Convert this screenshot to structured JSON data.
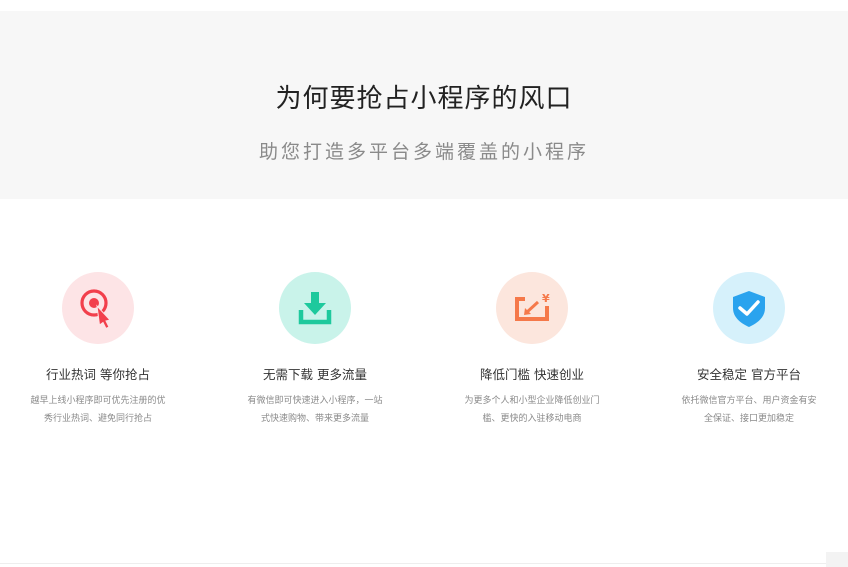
{
  "hero": {
    "title": "为何要抢占小程序的风口",
    "subtitle": "助您打造多平台多端覆盖的小程序"
  },
  "features": [
    {
      "icon": "target-cursor-icon",
      "title": "行业热词 等你抢占",
      "desc_line1": "越早上线小程序即可优先注册的优",
      "desc_line2": "秀行业热词、避免同行抢占",
      "color": "#f23f4c"
    },
    {
      "icon": "download-icon",
      "title": "无需下载 更多流量",
      "desc_line1": "有微信即可快速进入小程序，一站",
      "desc_line2": "式快速购物、带来更多流量",
      "color": "#1ec99d"
    },
    {
      "icon": "yuan-arrow-icon",
      "title": "降低门槛 快速创业",
      "desc_line1": "为更多个人和小型企业降低创业门",
      "desc_line2": "槛、更快的入驻移动电商",
      "color": "#f5794a"
    },
    {
      "icon": "shield-check-icon",
      "title": "安全稳定 官方平台",
      "desc_line1": "依托微信官方平台、用户资金有安",
      "desc_line2": "全保证、接口更加稳定",
      "color": "#2aa3ee"
    }
  ],
  "colors": {
    "hero_background": "#f7f7f7",
    "title_text": "#222222",
    "subtitle_text": "#8a8a8a"
  }
}
